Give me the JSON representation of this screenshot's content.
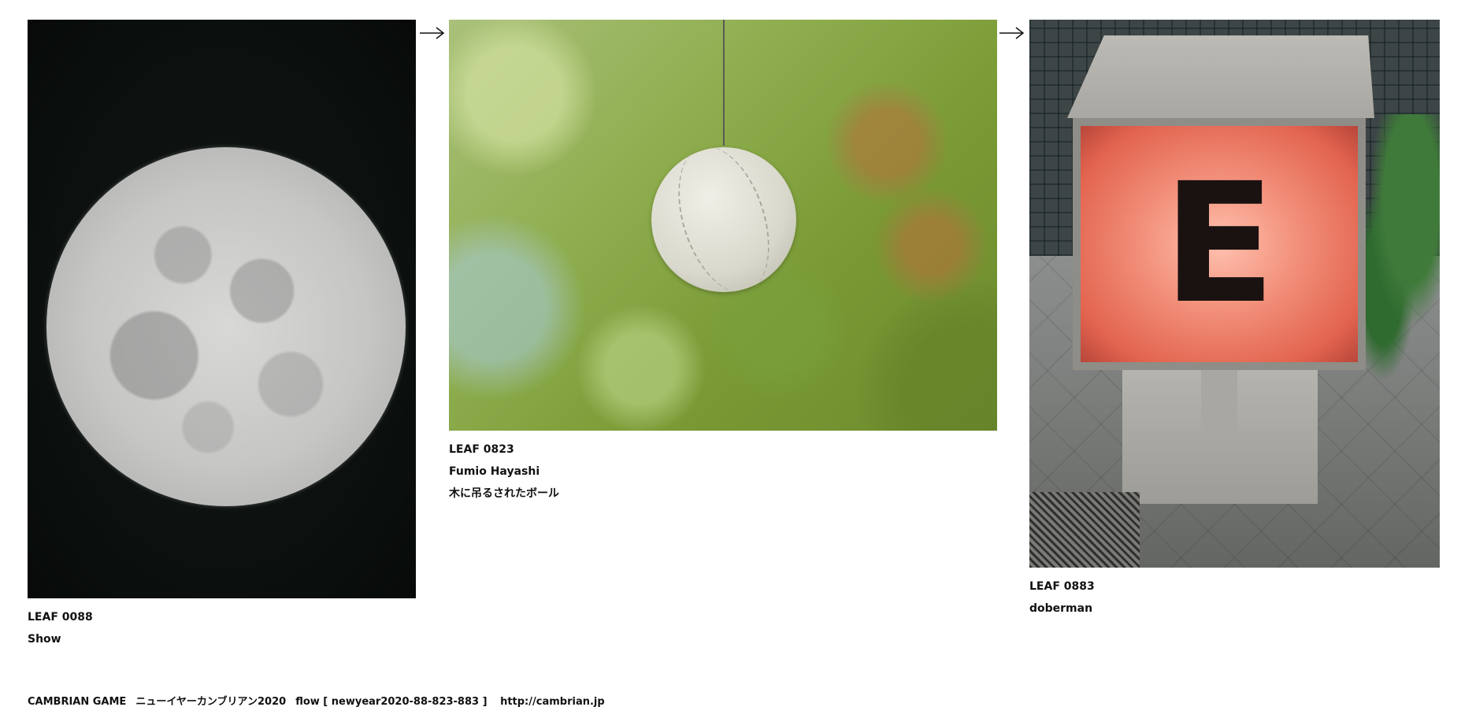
{
  "leaves": [
    {
      "number": "LEAF 0088",
      "lines": [
        "Show"
      ],
      "photo": "full-moon-photo"
    },
    {
      "number": "LEAF 0823",
      "lines": [
        "Fumio Hayashi",
        "木に吊るされたボール"
      ],
      "photo": "ball-hanging-in-tree-photo"
    },
    {
      "number": "LEAF 0883",
      "lines": [
        "doberman"
      ],
      "photo": "lit-sign-box-photo",
      "sign_letter": "E"
    }
  ],
  "arrows": [
    "right-arrow-icon",
    "right-arrow-icon"
  ],
  "footer": {
    "title": "CAMBRIAN GAME",
    "subtitle": "ニューイヤーカンブリアン2020",
    "flow": "flow [ newyear2020-88-823-883 ]",
    "url": "http://cambrian.jp"
  },
  "colors": {
    "text": "#111111",
    "background": "#ffffff"
  }
}
